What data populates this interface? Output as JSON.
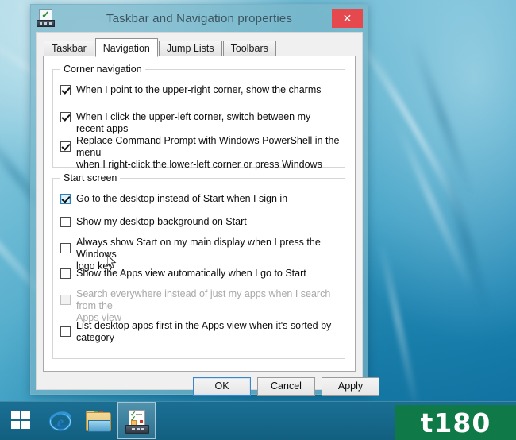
{
  "window": {
    "title": "Taskbar and Navigation properties",
    "icon": "taskbar-properties-icon",
    "close_label": "✕"
  },
  "tabs": [
    {
      "label": "Taskbar",
      "active": false
    },
    {
      "label": "Navigation",
      "active": true
    },
    {
      "label": "Jump Lists",
      "active": false
    },
    {
      "label": "Toolbars",
      "active": false
    }
  ],
  "groups": {
    "corner_navigation": {
      "title": "Corner navigation",
      "options": [
        {
          "label": "When I point to the upper-right corner, show the charms",
          "checked": true,
          "enabled": true
        },
        {
          "label": "When I click the upper-left corner, switch between my recent apps",
          "checked": true,
          "enabled": true
        },
        {
          "label": "Replace Command Prompt with Windows PowerShell in the menu\nwhen I right-click the lower-left corner or press Windows key +X",
          "checked": true,
          "enabled": true
        }
      ]
    },
    "start_screen": {
      "title": "Start screen",
      "options": [
        {
          "label": "Go to the desktop instead of Start when I sign in",
          "checked": true,
          "enabled": true,
          "hovered": true
        },
        {
          "label": "Show my desktop background on Start",
          "checked": false,
          "enabled": true
        },
        {
          "label": "Always show Start on my main display when I press the Windows\nlogo key",
          "checked": false,
          "enabled": true
        },
        {
          "label": "Show the Apps view automatically when I go to Start",
          "checked": false,
          "enabled": true
        },
        {
          "label": "Search everywhere instead of just my apps when I search from the\nApps view",
          "checked": false,
          "enabled": false
        },
        {
          "label": "List desktop apps first in the Apps view when it's sorted by\ncategory",
          "checked": false,
          "enabled": true
        }
      ]
    }
  },
  "buttons": {
    "ok": "OK",
    "cancel": "Cancel",
    "apply": "Apply"
  },
  "taskbar": {
    "items": [
      {
        "name": "start-button",
        "icon": "windows-logo-icon",
        "active": false
      },
      {
        "name": "internet-explorer-button",
        "icon": "internet-explorer-icon",
        "active": false
      },
      {
        "name": "file-explorer-button",
        "icon": "folder-icon",
        "active": false
      },
      {
        "name": "taskbar-properties-button",
        "icon": "taskbar-properties-icon",
        "active": true
      }
    ]
  },
  "watermark": {
    "text": "t180",
    "color": "#0f7a47"
  },
  "colors": {
    "title_bar": "#78b6c9",
    "close_button": "#e5484d",
    "dialog_background": "#f0f0f0",
    "tab_page": "#ffffff",
    "accent_focus": "#3d86c6",
    "taskbar": "#176a8d",
    "desktop_top": "#9fd2e1",
    "desktop_bottom": "#0d6f9e"
  }
}
